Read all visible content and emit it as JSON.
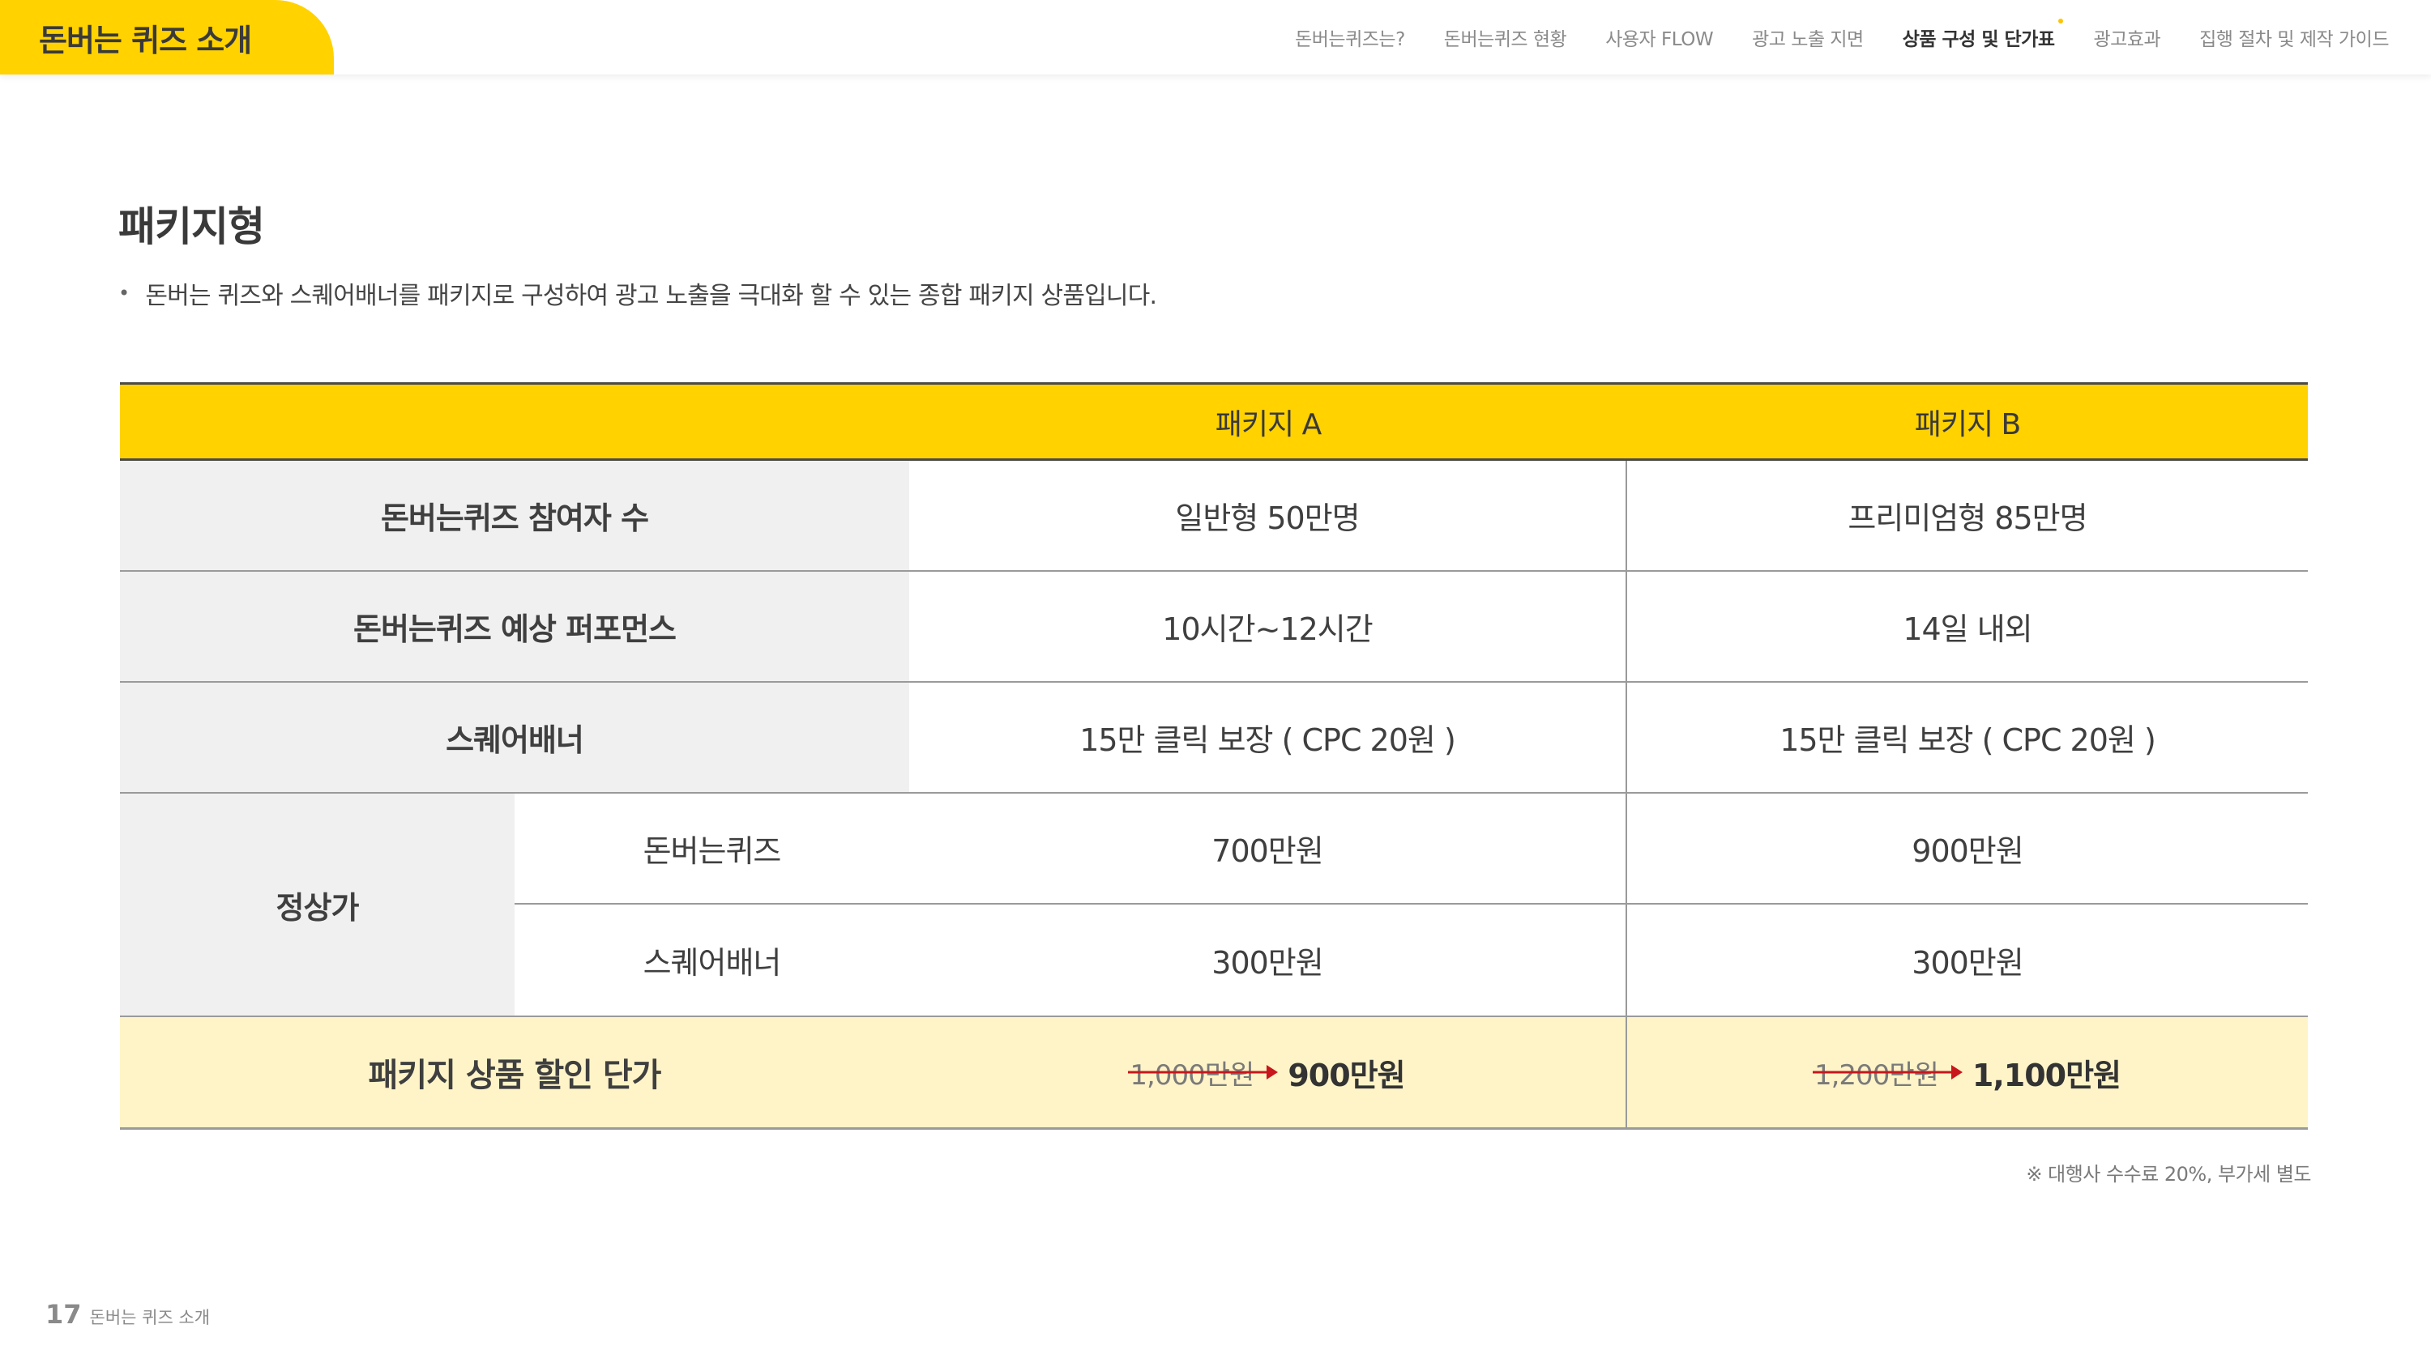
{
  "header": {
    "brand": "돈버는 퀴즈 소개",
    "nav": [
      {
        "label": "돈버는퀴즈는?",
        "active": false
      },
      {
        "label": "돈버는퀴즈 현황",
        "active": false
      },
      {
        "label": "사용자 FLOW",
        "active": false
      },
      {
        "label": "광고 노출 지면",
        "active": false
      },
      {
        "label": "상품 구성 및 단가표",
        "active": true
      },
      {
        "label": "광고효과",
        "active": false
      },
      {
        "label": "집행 절차 및 제작 가이드",
        "active": false
      }
    ]
  },
  "main": {
    "title": "패키지형",
    "description": "돈버는 퀴즈와 스퀘어배너를 패키지로 구성하여 광고 노출을 극대화 할 수 있는 종합 패키지 상품입니다.",
    "table": {
      "header": {
        "label": "",
        "a": "패키지 A",
        "b": "패키지 B"
      },
      "rows": [
        {
          "label": "돈버는퀴즈 참여자 수",
          "a": "일반형 50만명",
          "b": "프리미엄형 85만명"
        },
        {
          "label": "돈버는퀴즈 예상 퍼포먼스",
          "a": "10시간~12시간",
          "b": "14일 내외"
        },
        {
          "label": "스퀘어배너",
          "a": "15만 클릭 보장 ( CPC 20원 )",
          "b": "15만 클릭 보장 ( CPC 20원 )"
        }
      ],
      "price": {
        "label": "정상가",
        "items": [
          {
            "label": "돈버는퀴즈",
            "a": "700만원",
            "b": "900만원"
          },
          {
            "label": "스퀘어배너",
            "a": "300만원",
            "b": "300만원"
          }
        ]
      },
      "discount": {
        "label": "패키지 상품 할인 단가",
        "a": {
          "old": "1,000만원",
          "new": "900만원"
        },
        "b": {
          "old": "1,200만원",
          "new": "1,100만원"
        }
      }
    },
    "note": "※ 대행사 수수료 20%, 부가세 별도"
  },
  "footer": {
    "page": "17",
    "title": "돈버는 퀴즈 소개"
  },
  "colors": {
    "accent": "#ffd200",
    "highlight_row": "#fff4c8",
    "label_bg": "#f0f0f0",
    "strike": "#c8161d"
  }
}
